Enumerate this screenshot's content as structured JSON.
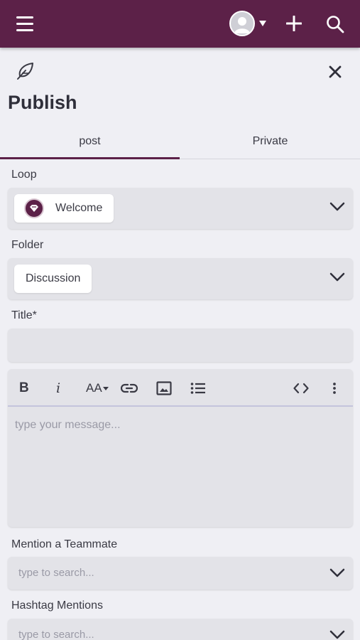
{
  "header": {
    "menu_icon": "hamburger-icon",
    "avatar_icon": "user-avatar-icon",
    "add_icon": "plus-icon",
    "search_icon": "search-icon",
    "bar_color": "#5c2148"
  },
  "panel": {
    "brand_icon": "feather-icon",
    "close_icon": "close-icon",
    "title": "Publish"
  },
  "tabs": [
    {
      "label": "post",
      "active": true
    },
    {
      "label": "Private",
      "active": false
    }
  ],
  "form": {
    "loop": {
      "label": "Loop",
      "value": "Welcome"
    },
    "folder": {
      "label": "Folder",
      "value": "Discussion"
    },
    "title": {
      "label": "Title*",
      "value": ""
    },
    "editor": {
      "toolbar": {
        "bold": "B",
        "italic": "i",
        "font_size": "AA",
        "items": [
          "bold-icon",
          "italic-icon",
          "font-size-icon",
          "link-icon",
          "image-icon",
          "list-icon",
          "code-icon",
          "more-icon"
        ]
      },
      "placeholder": "type your message..."
    },
    "mention": {
      "label": "Mention a Teammate",
      "placeholder": "type to search..."
    },
    "hashtag": {
      "label": "Hashtag Mentions",
      "placeholder": "type to search..."
    }
  }
}
